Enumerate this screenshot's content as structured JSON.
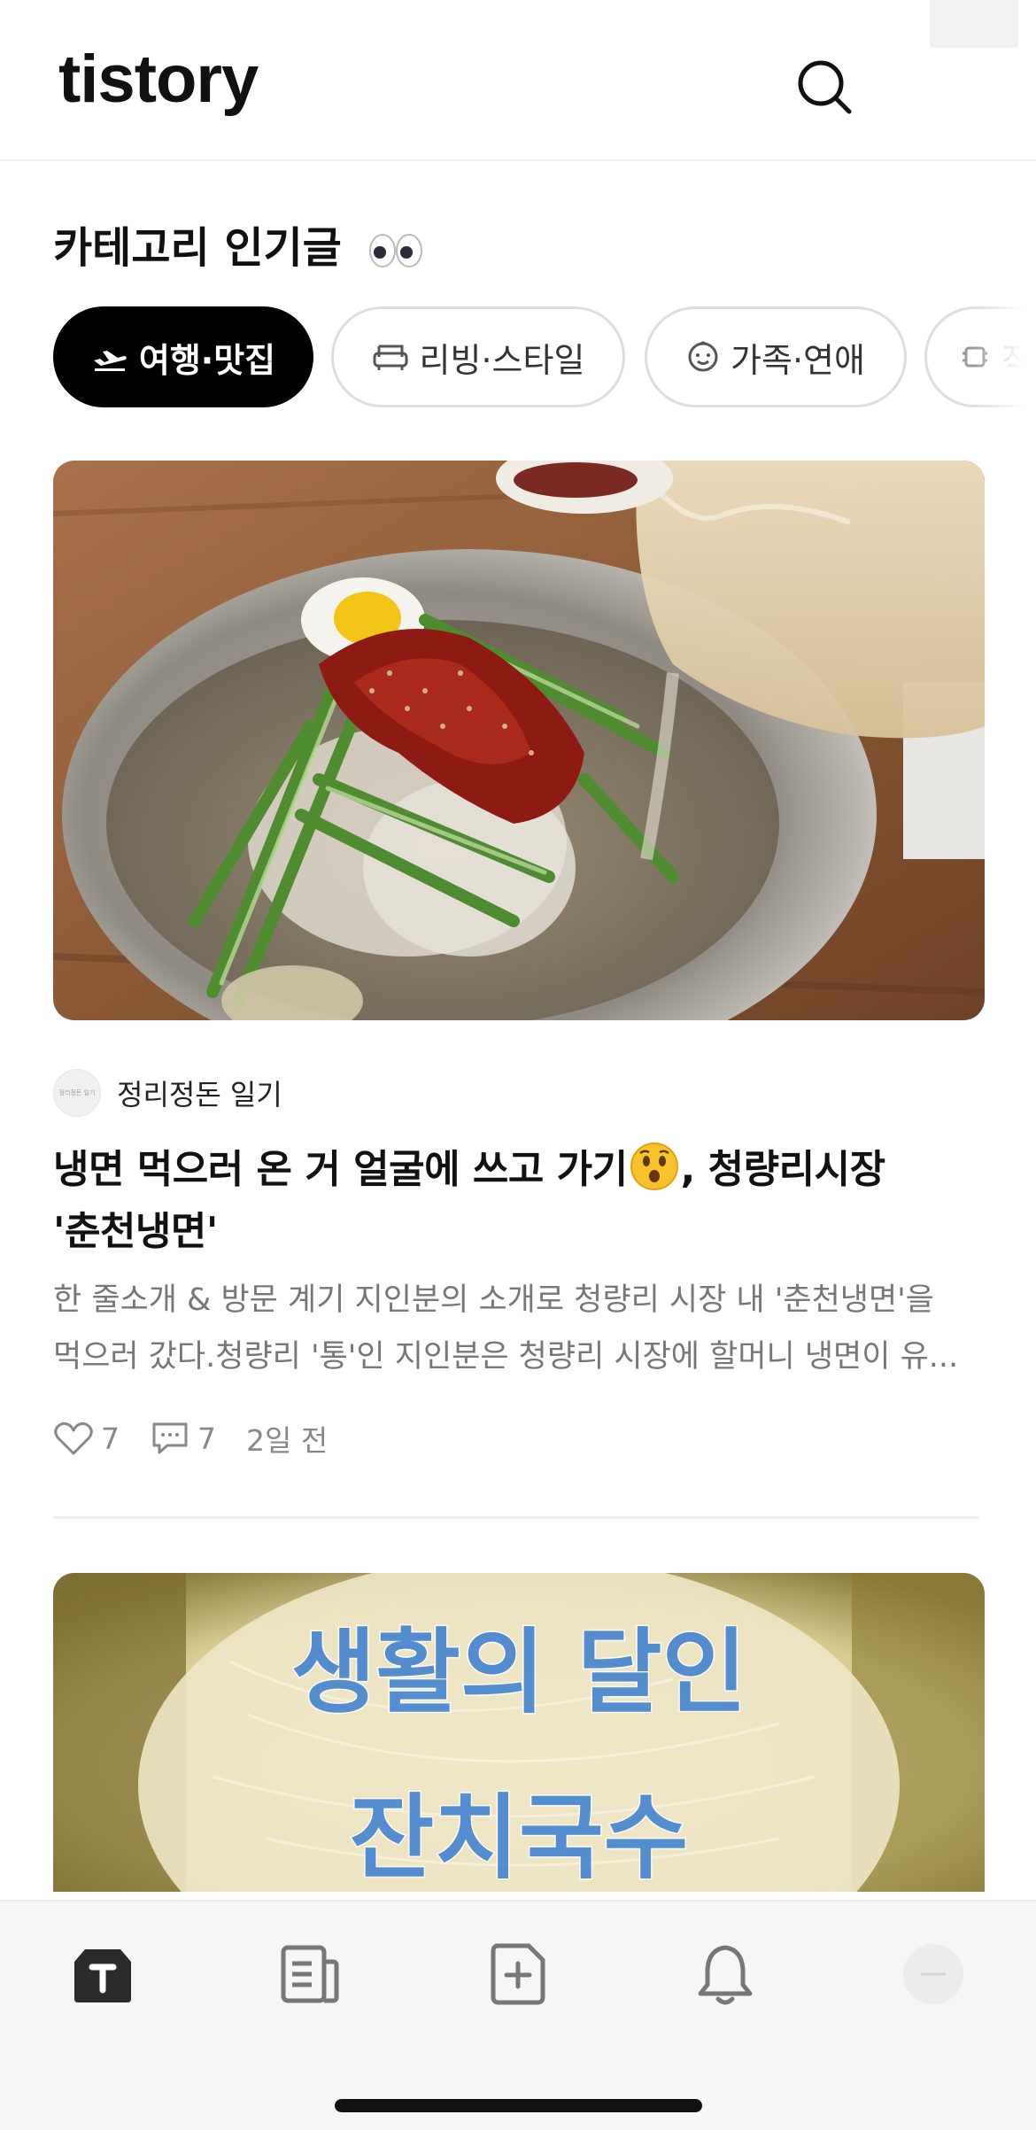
{
  "header": {
    "logo": "tistory",
    "search_icon": "search-icon"
  },
  "section": {
    "title": "카테고리 인기글",
    "title_emoji": "eyes"
  },
  "categories": [
    {
      "label": "여행·맛집",
      "icon": "airplane-icon",
      "active": true
    },
    {
      "label": "리빙·스타일",
      "icon": "sofa-icon",
      "active": false
    },
    {
      "label": "가족·연애",
      "icon": "baby-face-icon",
      "active": false
    },
    {
      "label": "직",
      "icon": "chip-icon",
      "active": false
    }
  ],
  "post": {
    "image": "food-photo",
    "blog_avatar_text": "정리정돈 일기",
    "blog_name": "정리정돈 일기",
    "title_part1": "냉면 먹으러 온 거 얼굴에 쓰고 가기",
    "title_emoji": "hushed-face",
    "title_part2": ", 청량리시장",
    "title_line2": "'춘천냉면'",
    "excerpt_line1": "한 줄소개 & 방문 계기 지인분의 소개로 청량리 시장 내 '춘천냉면'을",
    "excerpt_line2": "먹으러 갔다.청량리 '통'인 지인분은 청량리 시장에 할머니 냉면이 유...",
    "likes": "7",
    "comments": "7",
    "time": "2일 전"
  },
  "post2": {
    "image_text_line1": "생활의 달인",
    "image_text_line2": "잔치국수"
  },
  "tabbar": {
    "items": [
      "home-icon",
      "feed-icon",
      "write-icon",
      "bell-icon",
      "profile-icon"
    ]
  },
  "colors": {
    "active_chip_bg": "#000000",
    "muted_text": "#777777",
    "accent_blue": "#3a7fd0"
  }
}
